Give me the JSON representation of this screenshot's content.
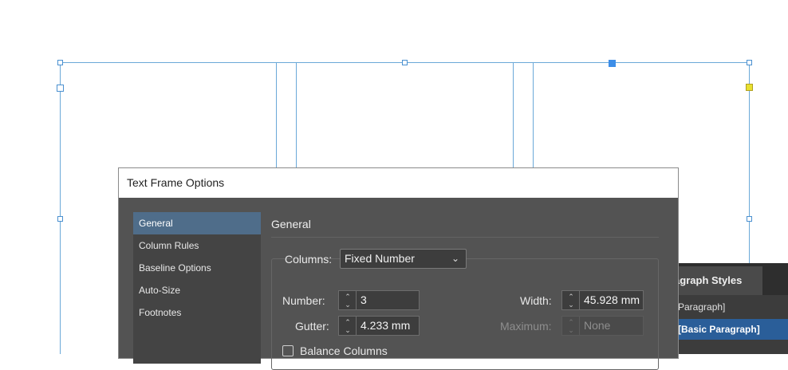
{
  "dialog": {
    "title": "Text Frame Options",
    "sidebar": [
      {
        "label": "General",
        "active": true
      },
      {
        "label": "Column Rules",
        "active": false
      },
      {
        "label": "Baseline Options",
        "active": false
      },
      {
        "label": "Auto-Size",
        "active": false
      },
      {
        "label": "Footnotes",
        "active": false
      }
    ],
    "section_title": "General",
    "columns": {
      "label": "Columns:",
      "value": "Fixed Number"
    },
    "number": {
      "label": "Number:",
      "value": "3"
    },
    "gutter": {
      "label": "Gutter:",
      "value": "4.233 mm"
    },
    "width": {
      "label": "Width:",
      "value": "45.928 mm"
    },
    "maximum": {
      "label": "Maximum:",
      "value": "None"
    },
    "balance_columns": {
      "label": "Balance Columns",
      "checked": false
    }
  },
  "paragraph_styles": {
    "tab_label": "ragraph Styles",
    "items": [
      {
        "label": "Paragraph]",
        "active": false
      },
      {
        "label": "[Basic Paragraph]",
        "active": true
      }
    ]
  },
  "colors": {
    "dialog_bg": "#535353",
    "sidebar_active": "#4f6d8a",
    "frame_guides": "#6aa8d8",
    "selected_handle": "#3d8ee8",
    "panel_active": "#2a5e99"
  }
}
